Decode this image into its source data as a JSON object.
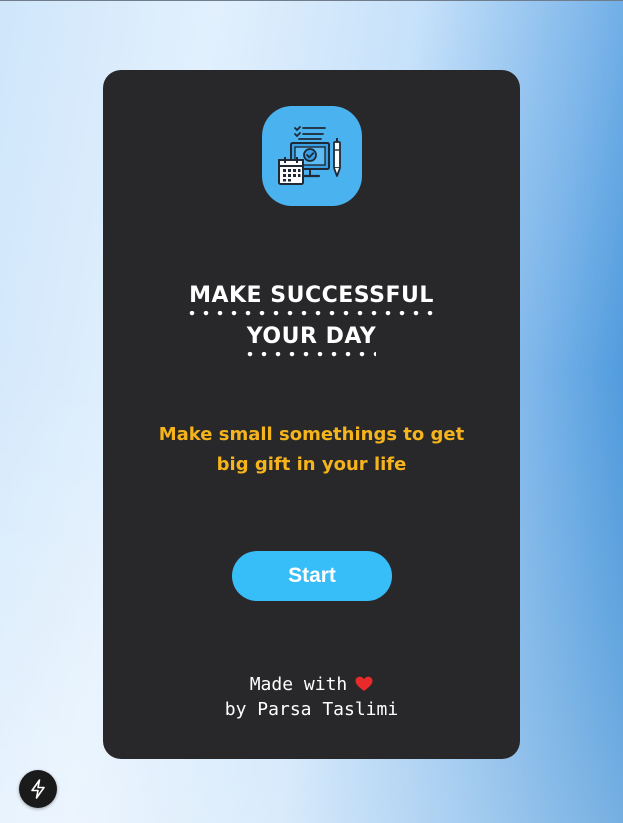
{
  "card": {
    "title_line1": "MAKE SUCCESSFUL",
    "title_line2": "YOUR DAY",
    "subtitle_line1": "Make small somethings to get",
    "subtitle_line2": "big gift in your life",
    "start_label": "Start",
    "credit_prefix": "Made with",
    "credit_author": "by Parsa Taslimi"
  },
  "icons": {
    "logo": "productivity-desk-icon",
    "heart": "heart-icon",
    "floating_button": "lightning-bolt-icon"
  },
  "colors": {
    "card_background": "#28282a",
    "logo_tile": "#4ab2ee",
    "subtitle": "#f6b41c",
    "start_button": "#37bdf8",
    "heart": "#e82a2a"
  }
}
